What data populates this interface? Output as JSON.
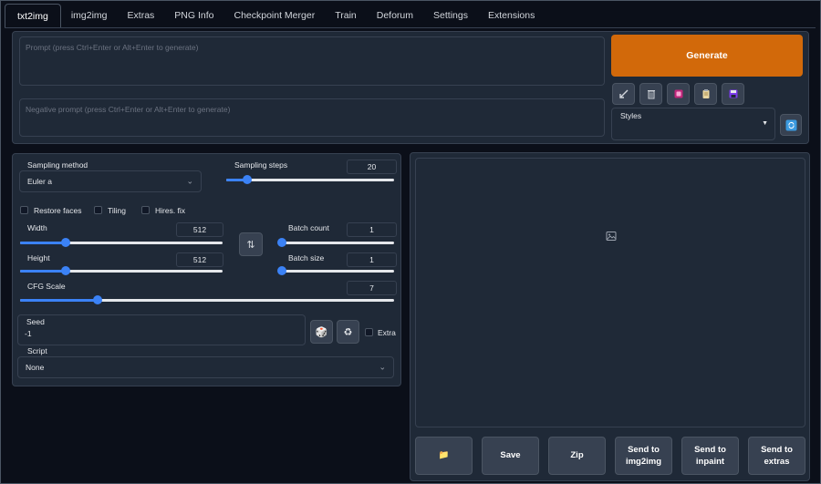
{
  "tabs": [
    "txt2img",
    "img2img",
    "Extras",
    "PNG Info",
    "Checkpoint Merger",
    "Train",
    "Deforum",
    "Settings",
    "Extensions"
  ],
  "active_tab": "txt2img",
  "prompt": {
    "placeholder": "Prompt (press Ctrl+Enter or Alt+Enter to generate)"
  },
  "negative_prompt": {
    "placeholder": "Negative prompt (press Ctrl+Enter or Alt+Enter to generate)"
  },
  "generate_label": "Generate",
  "tool_icons": [
    "arrow-icon",
    "trash-icon",
    "art-icon",
    "clipboard-icon",
    "save-icon"
  ],
  "styles": {
    "label": "Styles"
  },
  "sampling": {
    "label": "Sampling method",
    "value": "Euler a"
  },
  "sampling_steps": {
    "label": "Sampling steps",
    "value": "20",
    "min": 1,
    "max": 150,
    "current": 20
  },
  "options": {
    "restore_faces": "Restore faces",
    "tiling": "Tiling",
    "hires_fix": "Hires. fix"
  },
  "width": {
    "label": "Width",
    "value": "512",
    "min": 64,
    "max": 2048,
    "current": 512
  },
  "height": {
    "label": "Height",
    "value": "512",
    "min": 64,
    "max": 2048,
    "current": 512
  },
  "batch_count": {
    "label": "Batch count",
    "value": "1",
    "min": 1,
    "max": 100,
    "current": 1
  },
  "batch_size": {
    "label": "Batch size",
    "value": "1",
    "min": 1,
    "max": 8,
    "current": 1
  },
  "cfg": {
    "label": "CFG Scale",
    "value": "7",
    "min": 1,
    "max": 30,
    "current": 7
  },
  "seed": {
    "label": "Seed",
    "value": "-1",
    "extra_label": "Extra"
  },
  "script": {
    "label": "Script",
    "value": "None"
  },
  "bottom_buttons": [
    "Save",
    "Zip",
    "Send to img2img",
    "Send to inpaint",
    "Send to extras"
  ],
  "colors": {
    "accent": "#3b82f6",
    "generate": "#d2690a",
    "background": "#0b0f19",
    "panel": "#1f2937"
  }
}
